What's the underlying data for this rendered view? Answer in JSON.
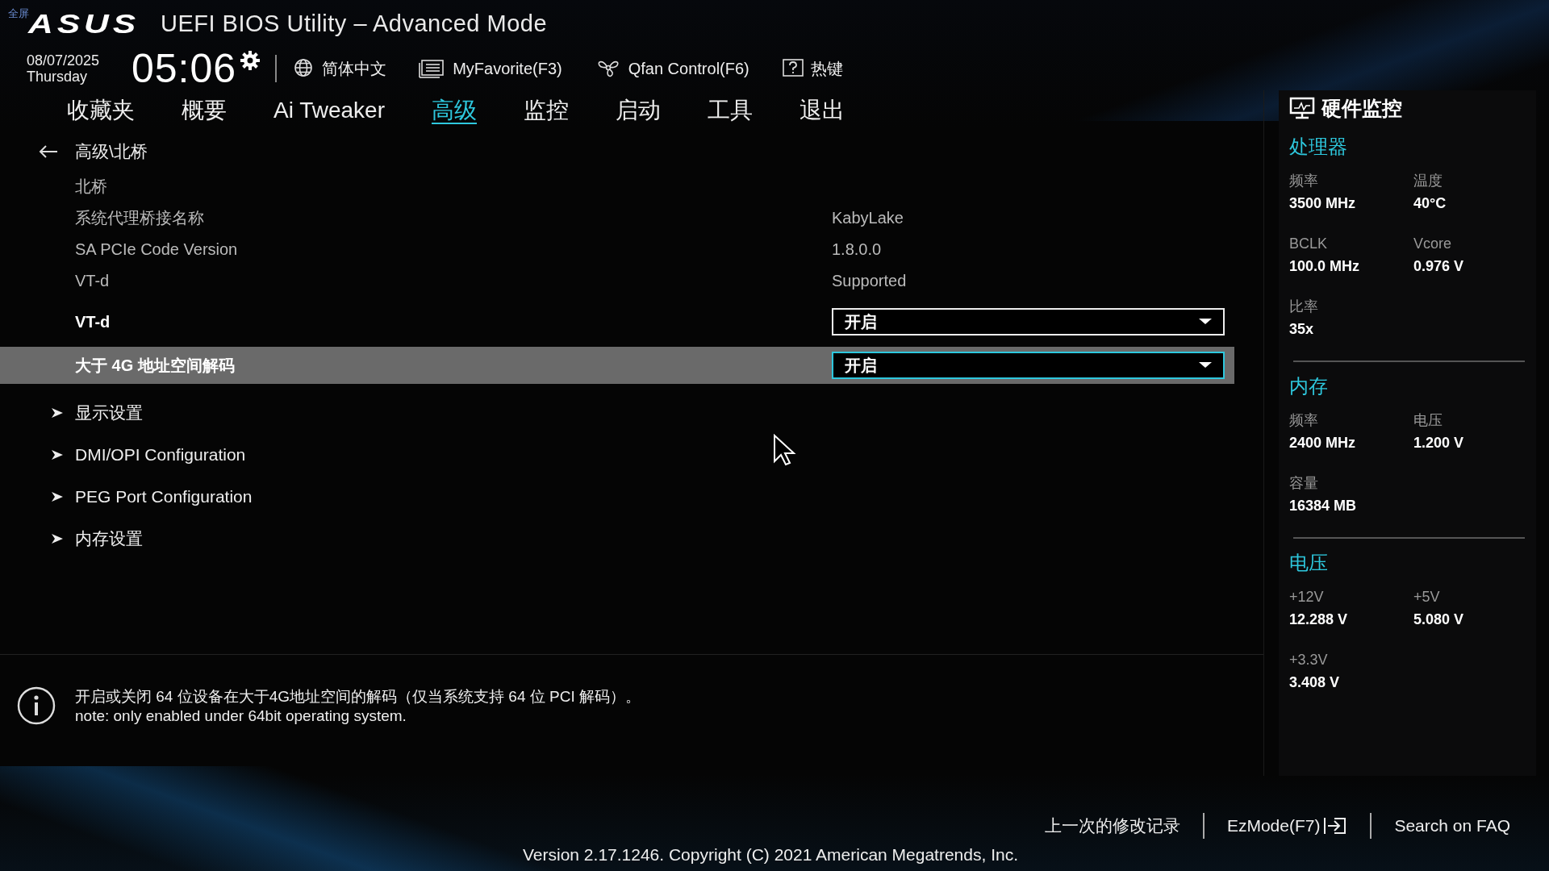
{
  "overlay_label": "全屏",
  "header": {
    "logo": "ASUS",
    "title": "UEFI BIOS Utility – Advanced Mode"
  },
  "toolbar": {
    "date": "08/07/2025",
    "weekday": "Thursday",
    "time": "05:06",
    "items": [
      {
        "kind": "language",
        "label": "简体中文"
      },
      {
        "kind": "favorite",
        "label": "MyFavorite(F3)"
      },
      {
        "kind": "fan",
        "label": "Qfan Control(F6)"
      },
      {
        "kind": "hotkey",
        "label": "热键"
      }
    ]
  },
  "tabs": [
    {
      "label": "收藏夹",
      "selected": false
    },
    {
      "label": "概要",
      "selected": false
    },
    {
      "label": "Ai Tweaker",
      "selected": false
    },
    {
      "label": "高级",
      "selected": true
    },
    {
      "label": "监控",
      "selected": false
    },
    {
      "label": "启动",
      "selected": false
    },
    {
      "label": "工具",
      "selected": false
    },
    {
      "label": "退出",
      "selected": false
    }
  ],
  "breadcrumb": "高级\\北桥",
  "items": [
    {
      "kind": "heading",
      "label": "北桥",
      "selected": false
    },
    {
      "kind": "info",
      "label": "系统代理桥接名称",
      "value": "KabyLake",
      "selected": false
    },
    {
      "kind": "info",
      "label": "SA PCIe Code Version",
      "value": "1.8.0.0",
      "selected": false
    },
    {
      "kind": "info",
      "label": "VT-d",
      "value": "Supported",
      "selected": false
    },
    {
      "kind": "dropdown",
      "label": "VT-d",
      "value": "开启",
      "selected": false
    },
    {
      "kind": "dropdown",
      "label": "大于 4G 地址空间解码",
      "value": "开启",
      "selected": true
    },
    {
      "kind": "submenu",
      "label": "显示设置",
      "selected": false
    },
    {
      "kind": "submenu",
      "label": "DMI/OPI Configuration",
      "selected": false
    },
    {
      "kind": "submenu",
      "label": "PEG Port Configuration",
      "selected": false
    },
    {
      "kind": "submenu",
      "label": "内存设置",
      "selected": false
    }
  ],
  "help": {
    "lines": [
      "开启或关闭 64 位设备在大于4G地址空间的解码（仅当系统支持 64 位 PCI 解码）。",
      "note: only enabled under 64bit operating system."
    ]
  },
  "hardware_monitor": {
    "title": "硬件监控",
    "sections": [
      {
        "title": "处理器",
        "readings": [
          {
            "label": "频率",
            "value": "3500 MHz"
          },
          {
            "label": "温度",
            "value": "40°C"
          },
          {
            "label": "BCLK",
            "value": "100.0 MHz"
          },
          {
            "label": "Vcore",
            "value": "0.976 V"
          },
          {
            "label": "比率",
            "value": "35x"
          }
        ]
      },
      {
        "title": "内存",
        "readings": [
          {
            "label": "频率",
            "value": "2400 MHz"
          },
          {
            "label": "电压",
            "value": "1.200 V"
          },
          {
            "label": "容量",
            "value": "16384 MB"
          }
        ]
      },
      {
        "title": "电压",
        "readings": [
          {
            "label": "+12V",
            "value": "12.288 V"
          },
          {
            "label": "+5V",
            "value": "5.080 V"
          },
          {
            "label": "+3.3V",
            "value": "3.408 V"
          }
        ]
      }
    ]
  },
  "footer": {
    "links": [
      {
        "kind": "history",
        "label": "上一次的修改记录"
      },
      {
        "kind": "ezmode",
        "label": "EzMode(F7)"
      },
      {
        "kind": "faq",
        "label": "Search on FAQ"
      }
    ],
    "version": "Version 2.17.1246. Copyright (C) 2021 American Megatrends, Inc."
  }
}
